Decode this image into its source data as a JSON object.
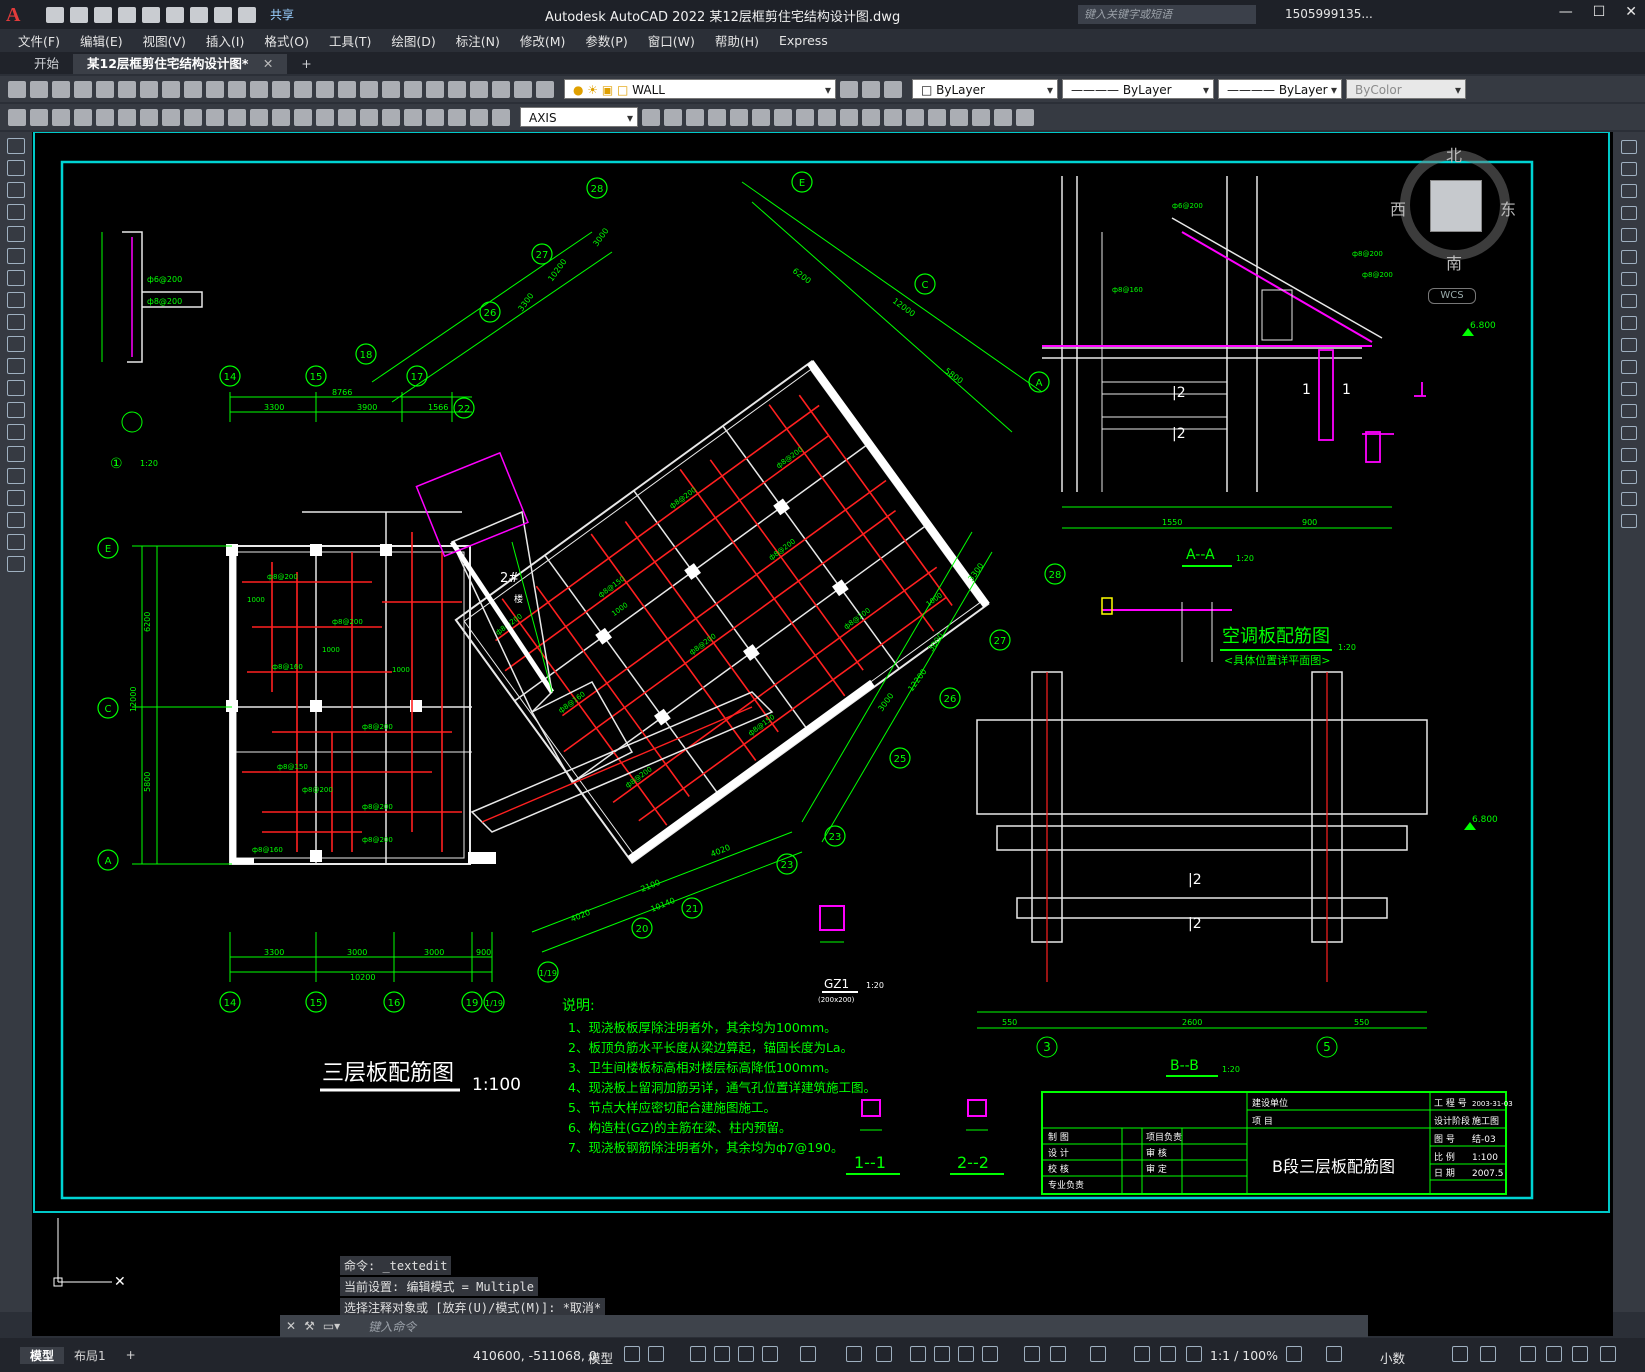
{
  "app": {
    "logo": "A",
    "title": "Autodesk AutoCAD 2022    某12层框剪住宅结构设计图.dwg",
    "share_label": "共享",
    "search_placeholder": "键入关键字或短语",
    "user": "1505999135...",
    "window_controls": [
      "—",
      "☐",
      "✕"
    ]
  },
  "menu": [
    "文件(F)",
    "编辑(E)",
    "视图(V)",
    "插入(I)",
    "格式(O)",
    "工具(T)",
    "绘图(D)",
    "标注(N)",
    "修改(M)",
    "参数(P)",
    "窗口(W)",
    "帮助(H)",
    "Express"
  ],
  "tabs": {
    "start": "开始",
    "file": "某12层框剪住宅结构设计图*",
    "close": "✕",
    "add": "+"
  },
  "toolbar": {
    "layer": "WALL",
    "color": "ByLayer",
    "linetype": "ByLayer",
    "lineweight": "ByLayer",
    "plotstyle": "ByColor",
    "dimstyle": "AXIS"
  },
  "viewcube": {
    "north": "北",
    "south": "南",
    "west": "西",
    "east": "东",
    "wcs": "WCS"
  },
  "drawing": {
    "plan_title": "三层板配筋图",
    "plan_scale": "1:100",
    "notes_title": "说明:",
    "notes": [
      "1、现浇板板厚除注明者外，其余均为100mm。",
      "2、板顶负筋水平长度从梁边算起，锚固长度为La。",
      "3、卫生间楼板标高相对楼层标高降低100mm。",
      "4、现浇板上留洞加筋另详，通气孔位置详建筑施工图。",
      "5、节点大样应密切配合建施图施工。",
      "6、构造柱(GZ)的主筋在梁、柱内预留。",
      "7、现浇板钢筋除注明者外，其余均为ф7@190。"
    ],
    "ac_title": "空调板配筋图",
    "ac_scale": "1:20",
    "ac_sub": "<具体位置详平面图>",
    "aa_label": "A--A",
    "aa_scale": "1:20",
    "bb_label": "B--B",
    "bb_scale": "1:20",
    "gz_label": "GZ1",
    "gz_scale": "1:20",
    "gz_size": "(200x200)",
    "sec11": "1--1",
    "sec22": "2--2",
    "detail1_label": "①",
    "detail1_scale": "1:20",
    "elev1": "6.800",
    "elev2": "6.800",
    "axes_bottom": [
      "14",
      "15",
      "16",
      "19",
      "1/19"
    ],
    "axes_bottom_dims": [
      "3300",
      "3000",
      "3000",
      "900"
    ],
    "axes_bottom_total": "10200",
    "axes_top": [
      "14",
      "15",
      "17",
      "18",
      "22"
    ],
    "axes_top_dims": [
      "3300",
      "3900",
      "1566"
    ],
    "axes_top_total": "8766",
    "axes_left": [
      "E",
      "C",
      "A"
    ],
    "axes_left_dims": [
      "6200",
      "5800"
    ],
    "axes_left_total": "12000",
    "axes_rot_right": [
      "28",
      "27",
      "26",
      "25",
      "23"
    ],
    "axes_rot_top": [
      "28",
      "27",
      "26",
      "18"
    ],
    "axes_rot_letters": [
      "E",
      "C",
      "A"
    ],
    "axes_rot_bottom": [
      "1/19",
      "20",
      "21",
      "23"
    ],
    "rot_dims_a": [
      "3300",
      "10200",
      "3000"
    ],
    "rot_dims_b": [
      "6200",
      "12000",
      "5800"
    ],
    "rot_dims_c": [
      "3300",
      "3000",
      "3000",
      "12200"
    ],
    "rot_dims_d": [
      "4020",
      "2100",
      "10140",
      "4020"
    ],
    "bb_axes": [
      "3",
      "5"
    ],
    "bb_dims": [
      "550",
      "2600",
      "550"
    ],
    "bb_sub_dims": [
      "150",
      "100",
      "150",
      "150",
      "150"
    ],
    "sec_top_dims": [
      "1550",
      "900"
    ],
    "stair_label": "2#",
    "stair_sub": "楼"
  },
  "titleblock": {
    "rows_left": [
      "制 图",
      "设 计",
      "校 核",
      "专业负责"
    ],
    "rows_mid": [
      "项目负责",
      "审 核",
      "审 定"
    ],
    "header": [
      "建设单位",
      "项 目"
    ],
    "name": "B段三层板配筋图",
    "right_labels": [
      "工 程 号",
      "设计阶段",
      "图 号",
      "比 例",
      "日 期"
    ],
    "right_values": [
      "2003-31-03",
      "施工图",
      "结-03",
      "1:100",
      "2007.5"
    ]
  },
  "command": {
    "history": [
      "命令: _textedit",
      "当前设置: 编辑模式 = Multiple",
      "选择注释对象或 [放弃(U)/模式(M)]: *取消*"
    ],
    "placeholder": "键入命令"
  },
  "status": {
    "layouts": [
      "模型",
      "布局1",
      "+"
    ],
    "coords": "410600, -511068, 0",
    "model": "模型",
    "scale": "1:1 / 100%",
    "units": "小数"
  }
}
